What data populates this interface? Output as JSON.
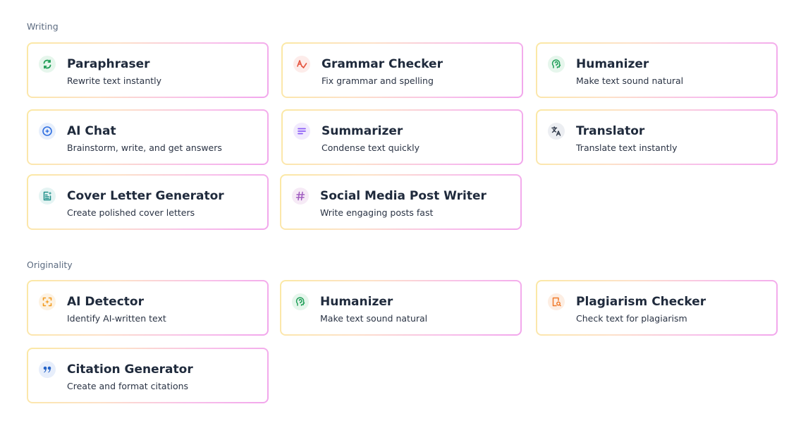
{
  "sections": [
    {
      "title": "Writing",
      "tools": [
        {
          "title": "Paraphraser",
          "desc": "Rewrite text instantly",
          "icon": "paraphraser-icon"
        },
        {
          "title": "Grammar Checker",
          "desc": "Fix grammar and spelling",
          "icon": "grammar-icon"
        },
        {
          "title": "Humanizer",
          "desc": "Make text sound natural",
          "icon": "brain-icon"
        },
        {
          "title": "AI Chat",
          "desc": "Brainstorm, write, and get answers",
          "icon": "chat-sparkle-icon"
        },
        {
          "title": "Summarizer",
          "desc": "Condense text quickly",
          "icon": "lines-icon"
        },
        {
          "title": "Translator",
          "desc": "Translate text instantly",
          "icon": "translate-icon"
        },
        {
          "title": "Cover Letter Generator",
          "desc": "Create polished cover letters",
          "icon": "document-sparkle-icon"
        },
        {
          "title": "Social Media Post Writer",
          "desc": "Write engaging posts fast",
          "icon": "hashtag-icon"
        }
      ]
    },
    {
      "title": "Originality",
      "tools": [
        {
          "title": "AI Detector",
          "desc": "Identify AI-written text",
          "icon": "scan-sparkle-icon"
        },
        {
          "title": "Humanizer",
          "desc": "Make text sound natural",
          "icon": "brain-icon"
        },
        {
          "title": "Plagiarism Checker",
          "desc": "Check text for plagiarism",
          "icon": "document-search-icon"
        },
        {
          "title": "Citation Generator",
          "desc": "Create and format citations",
          "icon": "quote-icon"
        }
      ]
    }
  ],
  "colors": {
    "paraphraser": "#1f9d55",
    "grammar": "#e5533d",
    "humanizer": "#22a05a",
    "ai_chat": "#2f6fe0",
    "summarizer": "#8b5cf6",
    "translator": "#2d3748",
    "cover_letter": "#1f8f8a",
    "social": "#a05cc0",
    "detector": "#f29a1d",
    "plagiarism": "#f07a2b",
    "citation": "#2563c7"
  }
}
